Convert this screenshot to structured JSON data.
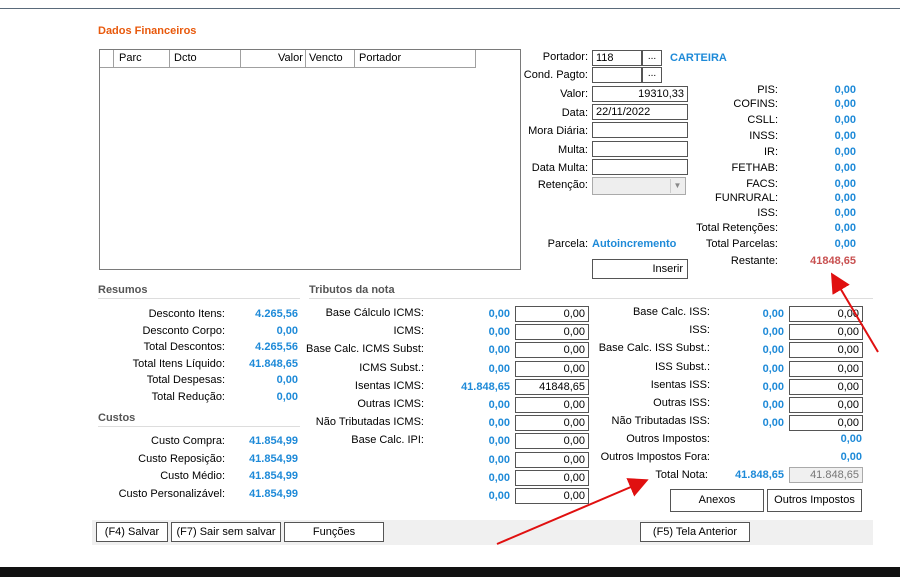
{
  "section_title": "Dados Financeiros",
  "grid": {
    "columns": [
      "Parc",
      "Dcto",
      "Valor",
      "Vencto",
      "Portador"
    ]
  },
  "form": {
    "portador_label": "Portador:",
    "portador_value": "118",
    "portador_btn": "...",
    "portador_name": "CARTEIRA",
    "cond_label": "Cond. Pagto:",
    "cond_value": "",
    "cond_btn": "...",
    "valor_label": "Valor:",
    "valor_value": "19310,33",
    "data_label": "Data:",
    "data_value": "22/11/2022",
    "mora_label": "Mora Diária:",
    "multa_label": "Multa:",
    "data_multa_label": "Data Multa:",
    "retencao_label": "Retenção:",
    "parcela_label": "Parcela:",
    "parcela_value": "Autoincremento",
    "inserir_btn": "Inserir"
  },
  "taxes": [
    {
      "label": "PIS:",
      "value": "0,00"
    },
    {
      "label": "COFINS:",
      "value": "0,00"
    },
    {
      "label": "CSLL:",
      "value": "0,00"
    },
    {
      "label": "INSS:",
      "value": "0,00"
    },
    {
      "label": "IR:",
      "value": "0,00"
    },
    {
      "label": "FETHAB:",
      "value": "0,00"
    },
    {
      "label": "FACS:",
      "value": "0,00"
    },
    {
      "label": "FUNRURAL:",
      "value": "0,00"
    },
    {
      "label": "ISS:",
      "value": "0,00"
    },
    {
      "label": "Total Retenções:",
      "value": "0,00"
    },
    {
      "label": "Total Parcelas:",
      "value": "0,00"
    },
    {
      "label": "Restante:",
      "value": "41848,65"
    }
  ],
  "resumos": {
    "title": "Resumos",
    "rows": [
      {
        "label": "Desconto Itens:",
        "value": "4.265,56"
      },
      {
        "label": "Desconto Corpo:",
        "value": "0,00"
      },
      {
        "label": "Total Descontos:",
        "value": "4.265,56"
      },
      {
        "label": "Total Itens Líquido:",
        "value": "41.848,65"
      },
      {
        "label": "Total Despesas:",
        "value": "0,00"
      },
      {
        "label": "Total Redução:",
        "value": "0,00"
      }
    ]
  },
  "custos": {
    "title": "Custos",
    "rows": [
      {
        "label": "Custo Compra:",
        "value": "41.854,99"
      },
      {
        "label": "Custo Reposição:",
        "value": "41.854,99"
      },
      {
        "label": "Custo Médio:",
        "value": "41.854,99"
      },
      {
        "label": "Custo Personalizável:",
        "value": "41.854,99"
      }
    ]
  },
  "tributos": {
    "title": "Tributos da nota",
    "left": [
      {
        "label": "Base Cálculo ICMS:",
        "value": "0,00",
        "input": "0,00"
      },
      {
        "label": "ICMS:",
        "value": "0,00",
        "input": "0,00"
      },
      {
        "label": "Base Calc. ICMS Subst:",
        "value": "0,00",
        "input": "0,00"
      },
      {
        "label": "ICMS Subst.:",
        "value": "0,00",
        "input": "0,00"
      },
      {
        "label": "Isentas ICMS:",
        "value": "41.848,65",
        "input": "41848,65"
      },
      {
        "label": "Outras ICMS:",
        "value": "0,00",
        "input": "0,00"
      },
      {
        "label": "Não Tributadas ICMS:",
        "value": "0,00",
        "input": "0,00"
      },
      {
        "label": "Base Calc. IPI:",
        "value": "0,00",
        "input": "0,00"
      },
      {
        "label": "",
        "value": "0,00",
        "input": "0,00"
      },
      {
        "label": "",
        "value": "0,00",
        "input": "0,00"
      },
      {
        "label": "",
        "value": "0,00",
        "input": "0,00"
      }
    ],
    "right": [
      {
        "label": "Base Calc. ISS:",
        "value": "0,00",
        "input": "0,00"
      },
      {
        "label": "ISS:",
        "value": "0,00",
        "input": "0,00"
      },
      {
        "label": "Base Calc. ISS Subst.:",
        "value": "0,00",
        "input": "0,00"
      },
      {
        "label": "ISS Subst.:",
        "value": "0,00",
        "input": "0,00"
      },
      {
        "label": "Isentas ISS:",
        "value": "0,00",
        "input": "0,00"
      },
      {
        "label": "Outras ISS:",
        "value": "0,00",
        "input": "0,00"
      },
      {
        "label": "Não Tributadas ISS:",
        "value": "0,00",
        "input": "0,00"
      }
    ],
    "outros_impostos_label": "Outros Impostos:",
    "outros_impostos_value": "0,00",
    "outros_fora_label": "Outros Impostos Fora:",
    "outros_fora_value": "0,00",
    "total_nota_label": "Total Nota:",
    "total_nota_value": "41.848,65",
    "total_nota_input": "41.848,65"
  },
  "buttons": {
    "anexos": "Anexos",
    "outros_impostos": "Outros Impostos",
    "salvar": "(F4) Salvar",
    "sair": "(F7) Sair sem salvar",
    "funcoes": "Funções",
    "tela_anterior": "(F5) Tela Anterior"
  },
  "colors": {
    "title": "#e8590c",
    "value_blue": "#1e8ad8",
    "restante_red": "#c85050",
    "annotation_arrow": "#e01010"
  }
}
